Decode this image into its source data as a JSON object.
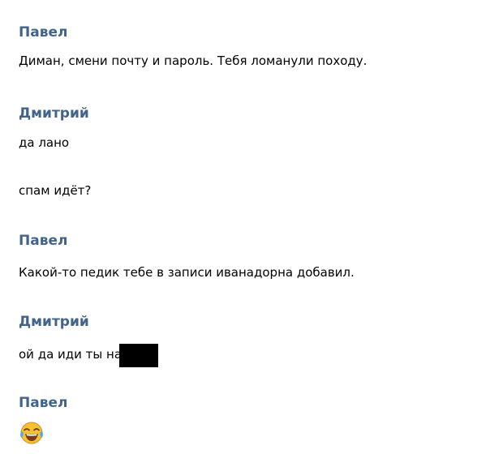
{
  "messages": [
    {
      "author": "Павел",
      "texts": [
        "Диман, смени почту и пароль. Тебя ломанули походу."
      ]
    },
    {
      "author": "Дмитрий",
      "texts": [
        "да лано",
        "спам идёт?"
      ]
    },
    {
      "author": "Павел",
      "texts": [
        "Какой-то педик тебе в записи иванадорна добавил."
      ]
    },
    {
      "author": "Дмитрий",
      "texts": [
        "ой да иди ты на"
      ]
    },
    {
      "author": "Павел",
      "emoji": "face-with-tears-of-joy-icon"
    }
  ],
  "colors": {
    "author": "#42648b",
    "text": "#000000",
    "redaction": "#000000",
    "emoji_face": "#f6c232"
  }
}
